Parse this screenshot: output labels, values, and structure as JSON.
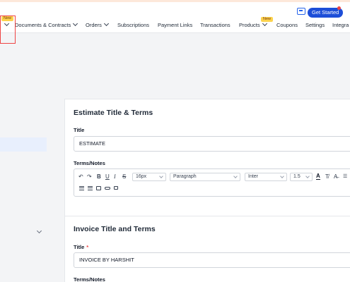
{
  "header": {
    "get_started_label": "Get Started"
  },
  "nav": {
    "first_badge": "New",
    "items": [
      {
        "label": "Documents & Contracts"
      },
      {
        "label": "Orders"
      },
      {
        "label": "Subscriptions"
      },
      {
        "label": "Payment Links"
      },
      {
        "label": "Transactions"
      },
      {
        "label": "Products",
        "badge": "New"
      },
      {
        "label": "Coupons"
      },
      {
        "label": "Settings"
      },
      {
        "label": "Integra"
      }
    ]
  },
  "estimate_section": {
    "title": "Estimate Title & Terms",
    "title_field_label": "Title",
    "title_value": "ESTIMATE",
    "terms_label": "Terms/Notes"
  },
  "editor_toolbar": {
    "font_size": "16px",
    "block_style": "Paragraph",
    "font_family": "Inter",
    "line_height": "1.5"
  },
  "invoice_section": {
    "title": "Invoice Title and Terms",
    "title_field_label": "Title",
    "required_mark": "*",
    "title_value": "INVOICE BY HARSHIT",
    "terms_label": "Terms/Notes"
  },
  "colors": {
    "accent": "#1d4ed8",
    "badge": "#fcd34d",
    "highlight": "#ef4444",
    "sidebar_active": "#e8effd"
  }
}
